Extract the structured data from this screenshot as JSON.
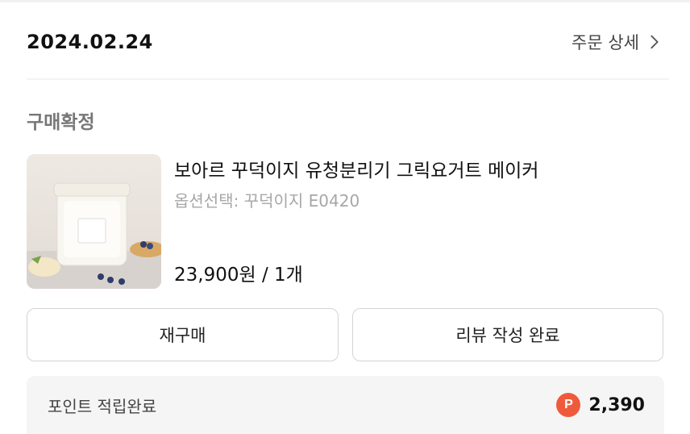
{
  "order": {
    "date": "2024.02.24",
    "detail_link_label": "주문 상세",
    "status": "구매확정"
  },
  "product": {
    "title": "보아르 꾸덕이지 유청분리기 그릭요거트 메이커",
    "option": "옵션선택: 꾸덕이지 E0420",
    "price": "23,900원 / 1개"
  },
  "actions": {
    "rebuy_label": "재구매",
    "review_label": "리뷰 작성 완료"
  },
  "points": {
    "label": "포인트 적립완료",
    "badge": "P",
    "amount": "2,390",
    "badge_color": "#ef5a3c"
  },
  "icons": {
    "detail": "chevron-right-icon",
    "points": "point-p-icon"
  }
}
